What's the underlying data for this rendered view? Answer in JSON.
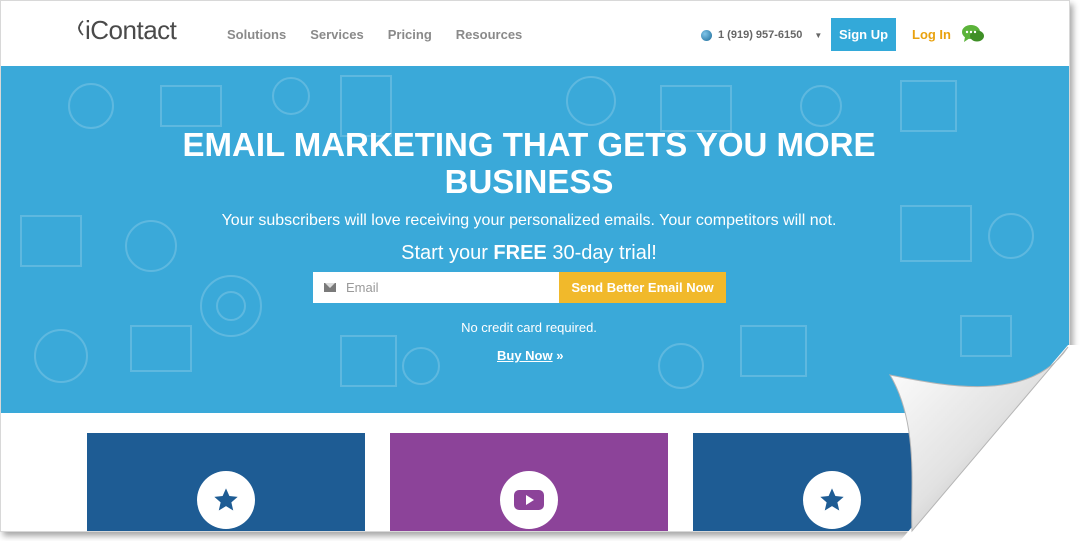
{
  "header": {
    "logo": "iContact",
    "nav": [
      "Solutions",
      "Services",
      "Pricing",
      "Resources"
    ],
    "phone": "1 (919) 957-6150",
    "signup_label": "Sign Up",
    "login_label": "Log In"
  },
  "hero": {
    "headline_line1": "EMAIL MARKETING THAT GETS YOU MORE",
    "headline_line2": "BUSINESS",
    "subtitle": "Your subscribers will love receiving your personalized emails. Your competitors will not.",
    "trial_prefix": "Start your",
    "trial_bold": "FREE",
    "trial_suffix": "30-day trial!",
    "email_placeholder": "Email",
    "cta_label": "Send Better Email Now",
    "no_card": "No credit card required.",
    "buy_now": "Buy Now",
    "buy_now_suffix": "»"
  },
  "cards": [
    {
      "icon": "star-icon",
      "color": "#1e5c94"
    },
    {
      "icon": "video-play-icon",
      "color": "#8c4399"
    },
    {
      "icon": "star-icon",
      "color": "#1e5c94"
    }
  ],
  "colors": {
    "hero_bg": "#3aa9d9",
    "signup_bg": "#33a9d9",
    "login_text": "#e9a20f",
    "cta_bg": "#f1b92b"
  }
}
